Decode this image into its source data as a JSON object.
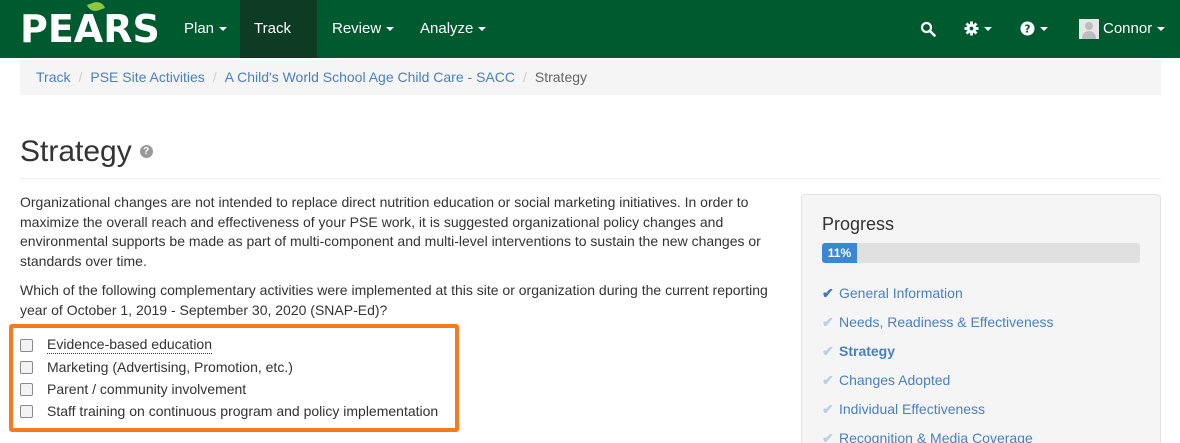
{
  "brand": {
    "logo_text": "PEARS"
  },
  "nav": {
    "items": [
      {
        "label": "Plan"
      },
      {
        "label": "Track"
      },
      {
        "label": "Review"
      },
      {
        "label": "Analyze"
      }
    ],
    "user": "Connor",
    "icons": [
      "search-icon",
      "gear-icon",
      "help-icon"
    ]
  },
  "breadcrumb": {
    "items": [
      {
        "label": "Track"
      },
      {
        "label": "PSE Site Activities"
      },
      {
        "label": "A Child's World School Age Child Care - SACC"
      }
    ],
    "current": "Strategy"
  },
  "page": {
    "title": "Strategy",
    "help_glyph": "?",
    "intro": "Organizational changes are not intended to replace direct nutrition education or social marketing initiatives. In order to maximize the overall reach and effectiveness of your PSE work, it is suggested organizational policy changes and environmental supports be made as part of multi-component and multi-level interventions to sustain the new changes or standards over time.",
    "question": "Which of the following complementary activities were implemented at this site or organization during the current reporting year of October 1, 2019 - September 30, 2020 (SNAP-Ed)?",
    "options": [
      {
        "label": "Evidence-based education",
        "checked": false
      },
      {
        "label": "Marketing (Advertising, Promotion, etc.)",
        "checked": false
      },
      {
        "label": "Parent / community involvement",
        "checked": false
      },
      {
        "label": "Staff training on continuous program and policy implementation",
        "checked": false
      }
    ]
  },
  "progress": {
    "title": "Progress",
    "percent_label": "11%",
    "percent": 11,
    "steps": [
      {
        "label": "General Information",
        "status": "done"
      },
      {
        "label": "Needs, Readiness & Effectiveness",
        "status": "pending"
      },
      {
        "label": "Strategy",
        "status": "current"
      },
      {
        "label": "Changes Adopted",
        "status": "pending"
      },
      {
        "label": "Individual Effectiveness",
        "status": "pending"
      },
      {
        "label": "Recognition & Media Coverage",
        "status": "pending"
      }
    ]
  },
  "colors": {
    "navbar": "#005a30",
    "nav_active": "#0e3b24",
    "link": "#4a7fc0",
    "progress_fill": "#3a87d8",
    "highlight": "#f47b20"
  }
}
